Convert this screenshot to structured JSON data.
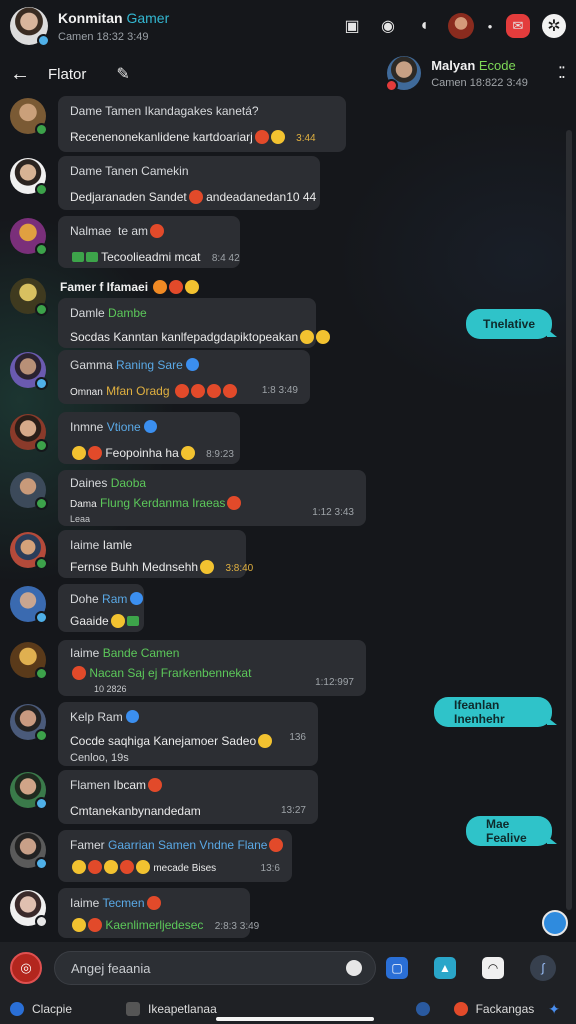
{
  "header": {
    "name": "Konmitan",
    "name_accent": "Gamer",
    "subtitle": "Camen 18:32 3:49"
  },
  "subheader": {
    "back_icon": "arrow-left-icon",
    "title": "Flator",
    "edit_icon": "pencil-icon"
  },
  "peer": {
    "name": "Malyan",
    "name_accent": "Ecode",
    "subtitle": "Camen 18:822 3:49"
  },
  "messages": [
    {
      "line1": "Dame Tamen Ikandagakes kanetá?",
      "line2": "Recenenonekanlidene kartdoariarj",
      "time": "3:44"
    },
    {
      "line1": "Dame Tanen Camekin",
      "line2": "Dedjaranaden Sandet",
      "line2b": "andeadanedan10 44"
    },
    {
      "line1": "Nalmae  te am",
      "line2": "Tecoolieadmi mcat",
      "time": "8:4 42"
    },
    {
      "line1": "Famer f Ifamaei"
    },
    {
      "line1": "Damle",
      "line1_green": "Dambe",
      "line2": "Socdas Kanntan kanlfepadgdapiktopeakan"
    },
    {
      "line1": "Gamma",
      "line1_blue": "Raning Sare",
      "line2_prefix": "Omnan",
      "line2_gold": "Mfan Oradg",
      "time": "1:8 3:49"
    },
    {
      "line1": "Inmne",
      "line1_blue": "Vtione",
      "line2": "Feopoinha ha",
      "time": "8:9:23"
    },
    {
      "line1": "Daines",
      "line1_green": "Daoba",
      "line2_prefix": "Dama",
      "line2_green": "Flung Kerdanma Iraeas",
      "line3": "Leaa",
      "time": "1:12 3:43"
    },
    {
      "line1": "Iaime",
      "line1_plain": "Iamle",
      "line2": "Fernse Buhh Mednsehh",
      "time": "3:8:40"
    },
    {
      "line1": "Dohe",
      "line1_blue": "Ram",
      "line2": "Gaaide"
    },
    {
      "line1": "Iaime",
      "line1_green": "Bande Camen",
      "line2_green": "Nacan Saj ej Frarkenbennekat",
      "line3": "10 2826",
      "time": "1:12:997"
    },
    {
      "line1": "Kelp Ram",
      "line2": "Cocde saqhiga Kanejamoer Sadeo",
      "line3": "Cenloo, 19s",
      "time": "136"
    },
    {
      "line1": "Flamen",
      "line1_plain": "Ibcam",
      "line2": "Cmtanekanbynandedam",
      "time": "13:27"
    },
    {
      "line1": "Famer",
      "line1_blue": "Gaarrian Samen Vndne",
      "line1_blue2": "Flane",
      "line2": "mecade Bises",
      "time": "13:6"
    },
    {
      "line1": "Iaime",
      "line1_blue": "Tecmen",
      "line2_green": "Kaenlimerljedesec",
      "time": "2:8:3 3:49"
    }
  ],
  "outgoing": [
    {
      "text": "Tnelative"
    },
    {
      "text": "Ifeanlan Inenhehr"
    },
    {
      "text": "Mae Fealive"
    }
  ],
  "composer": {
    "placeholder": "Angej feaania",
    "mic_icon": "voice-icon"
  },
  "bottomnav": {
    "item1": "Clacpie",
    "item2": "Ikeapetlanaa",
    "item3": "Fackangas"
  }
}
